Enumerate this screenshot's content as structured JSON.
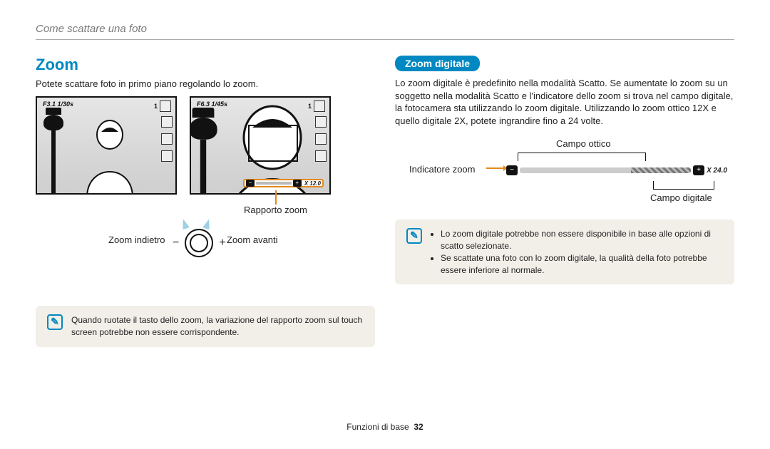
{
  "breadcrumb": "Come scattare una foto",
  "left": {
    "heading": "Zoom",
    "intro": "Potete scattare foto in primo piano regolando lo zoom.",
    "preview1_osd": "F3.1  1/30s",
    "preview2_osd": "F6.3  1/45s",
    "osd_count": "1",
    "zoom_ratio_text": "X 12.0",
    "label_ratio": "Rapporto zoom",
    "label_zoom_out": "Zoom indietro",
    "label_zoom_in": "Zoom avanti",
    "dial_minus": "−",
    "dial_plus": "+",
    "note": "Quando ruotate il tasto dello zoom, la variazione del rapporto zoom sul touch screen potrebbe non essere corrispondente."
  },
  "right": {
    "subhead": "Zoom digitale",
    "para": "Lo zoom digitale è predefinito nella modalità Scatto. Se aumentate lo zoom su un soggetto nella modalità Scatto e l'indicatore dello zoom si trova nel campo digitale, la fotocamera sta utilizzando lo zoom digitale. Utilizzando lo zoom ottico 12X e quello digitale 2X, potete ingrandire fino a 24 volte.",
    "label_optical": "Campo ottico",
    "label_indicator": "Indicatore zoom",
    "label_digital": "Campo digitale",
    "bar_minus": "−",
    "bar_plus": "+",
    "bar_end": "X 24.0",
    "notes": [
      "Lo zoom digitale potrebbe non essere disponibile in base alle opzioni di scatto selezionate.",
      "Se scattate una foto con lo zoom digitale, la qualità della foto potrebbe essere inferiore al normale."
    ]
  },
  "footer": {
    "section": "Funzioni di base",
    "page": "32"
  }
}
